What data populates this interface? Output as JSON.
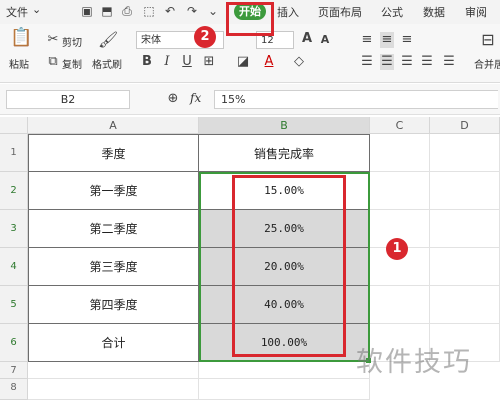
{
  "menu": {
    "file": "文件",
    "tabs": [
      "开始",
      "插入",
      "页面布局",
      "公式",
      "数据",
      "审阅"
    ]
  },
  "ribbon": {
    "paste": "粘贴",
    "cut": "剪切",
    "copy": "复制",
    "format_painter": "格式刷",
    "font_name": "宋体",
    "font_size": "12",
    "merge": "合并居"
  },
  "formula_bar": {
    "cell_ref": "B2",
    "fx": "fx",
    "value": "15%"
  },
  "sheet": {
    "columns": [
      "A",
      "B",
      "C",
      "D"
    ],
    "rows": [
      "1",
      "2",
      "3",
      "4",
      "5",
      "6",
      "7",
      "8"
    ],
    "header": [
      "季度",
      "销售完成率"
    ],
    "data": [
      [
        "第一季度",
        "15.00%"
      ],
      [
        "第二季度",
        "25.00%"
      ],
      [
        "第三季度",
        "20.00%"
      ],
      [
        "第四季度",
        "40.00%"
      ],
      [
        "合计",
        "100.00%"
      ]
    ]
  },
  "annotations": {
    "marker_1": "1",
    "marker_2": "2"
  },
  "watermark": "软件技巧",
  "colors": {
    "accent_green": "#3c9a3c",
    "annotation_red": "#d9272e"
  }
}
